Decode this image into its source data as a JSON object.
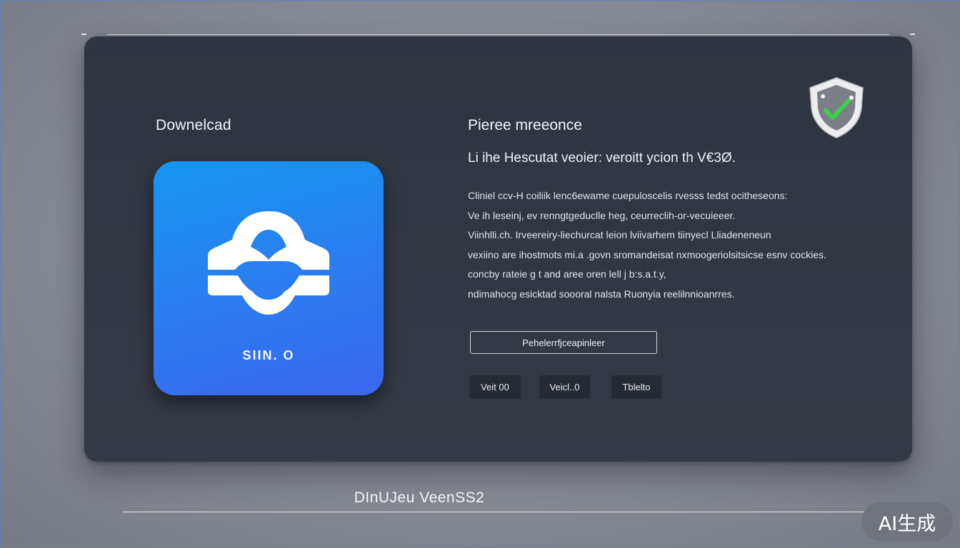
{
  "left_panel": {
    "heading": "Downelcad",
    "app_name": "SIIN. O",
    "tile_gradient": [
      "#1596f0",
      "#3a66ee"
    ]
  },
  "right_panel": {
    "heading": "Pieree mreeonce",
    "subheading": "Li ihe Hescutat veoier: veroitt ycion th V€3Ø.",
    "description_lines": [
      "Cliniel ccv-H coiliik lenc6ewame cuepuloscelis rvesss tedst ocitheseons:",
      "Ve ih leseinj, ev renngtgeduclle heg, ceurreclih-or-vecuieeer.",
      "Viinhlli.ch. Irveereiry-liechurcat leion lviivarhem tiinyecl Lliadeneneun",
      "vexiino are ihostmots mi.a .govn sromandeisat nxmoogeriolsitsicse esnv cockies.",
      "concby rateie g t and aree oren lell j b:s.a.t.y,",
      "ndimahocg esicktad soooral nalsta Ruonyia reelilnnioanrres."
    ],
    "primary_button": "Pehelerrfjceapinleer",
    "version_buttons": [
      "Veit 00",
      "Veicl..0",
      "Tblelto"
    ]
  },
  "footer": {
    "text": "DInUJeu VeenSS2"
  },
  "watermark": {
    "text": "AI生成"
  },
  "icons": {
    "app_logo": "cloud-bridge-logo-icon",
    "badge": "shield-check-icon"
  },
  "colors": {
    "card": "#2f3540",
    "button_dark": "#262b33",
    "check_green": "#3ad14a"
  }
}
